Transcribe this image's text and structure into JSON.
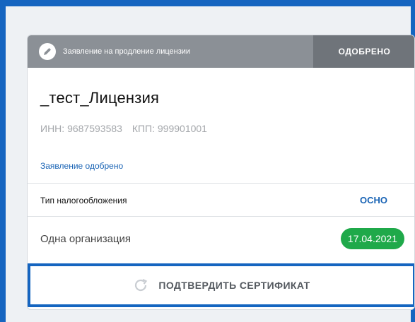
{
  "card": {
    "header": {
      "title": "Заявление на продление лицензии",
      "status": "ОДОБРЕНО",
      "icon": "edit-icon"
    },
    "org_name": "_тест_Лицензия",
    "inn": "ИНН: 9687593583",
    "kpp": "КПП: 999901001",
    "approved_link": "Заявление одобрено",
    "tax": {
      "label": "Тип налогообложения",
      "value": "ОСНО"
    },
    "org_type": "Одна организация",
    "date_badge": "17.04.2021",
    "confirm_button": {
      "label": "ПОДТВЕРДИТЬ СЕРТИФИКАТ",
      "icon": "refresh-icon"
    }
  },
  "colors": {
    "accent": "#1565c0",
    "header": "#8b9096",
    "status_bg": "#6f747a",
    "badge": "#1fa94a",
    "link": "#1a64b5"
  }
}
